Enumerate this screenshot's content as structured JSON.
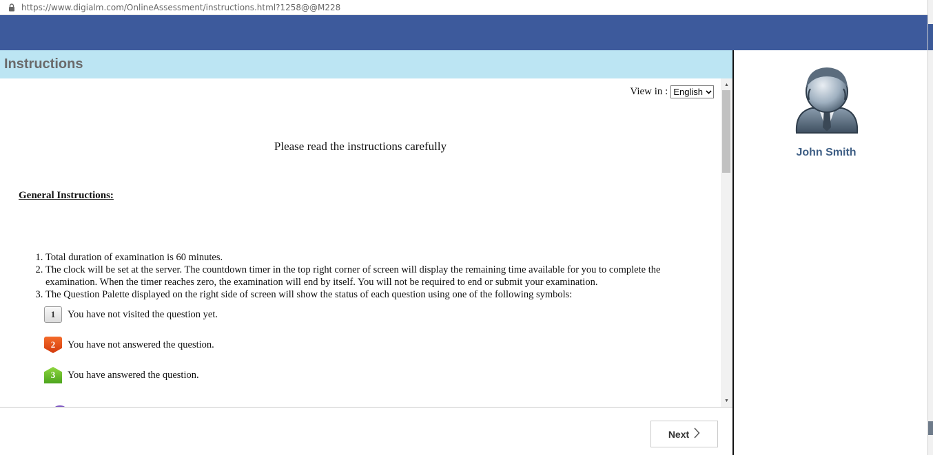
{
  "browser": {
    "url": "https://www.digialm.com/OnlineAssessment/instructions.html?1258@@M228"
  },
  "page": {
    "title": "Instructions",
    "view_in_label": "View in :",
    "language_selected": "English",
    "intro": "Please read the instructions carefully",
    "general_heading": "General Instructions:",
    "instructions": [
      "Total duration of examination is 60 minutes.",
      "The clock will be set at the server. The countdown timer in the top right corner of screen will display the remaining time available for you to complete the examination. When the timer reaches zero, the examination will end by itself. You will not be required to end or submit your examination.",
      "The Question Palette displayed on the right side of screen will show the status of each question using one of the following symbols:"
    ],
    "symbols": [
      {
        "number": "1",
        "text": "You have not visited the question yet."
      },
      {
        "number": "2",
        "text": "You have not answered the question."
      },
      {
        "number": "3",
        "text": "You have answered the question."
      }
    ],
    "next_label": "Next"
  },
  "profile": {
    "name": "John Smith"
  },
  "colors": {
    "banner": "#3d5a9c",
    "title_bar": "#bce5f3",
    "name_text": "#3f5f85"
  }
}
